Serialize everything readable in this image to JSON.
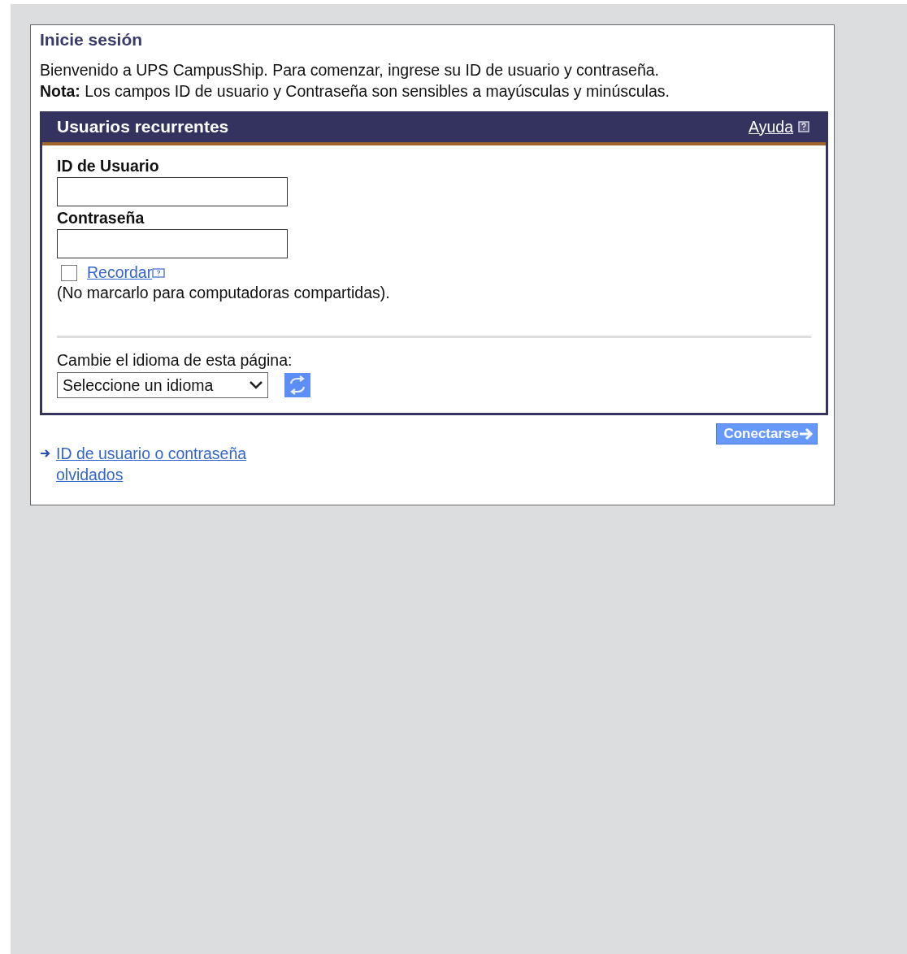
{
  "page_title": "Inicie sesión",
  "intro": "Bienvenido a UPS CampusShip. Para comenzar, ingrese su ID de usuario y contraseña.",
  "note": "**Nota:** Los campos ID de usuario y Contraseña son sensibles a mayúsculas y minúsculas.",
  "panel": {
    "title": "Usuarios recurrentes",
    "help_link": "Ayuda",
    "fields": [
      {
        "label": "ID de Usuario"
      },
      {
        "label": "Contraseña"
      }
    ],
    "remember": {
      "label": "Recordar",
      "checked": false
    },
    "remember_hint": "(No marcarlo para computadoras compartidas).",
    "language_label": "Cambie el idioma de esta página:",
    "language_select": {
      "value": "Seleccione un idioma"
    }
  },
  "login_button": "Conectarse",
  "forgot_link": "ID de usuario o contraseña olvidados"
}
